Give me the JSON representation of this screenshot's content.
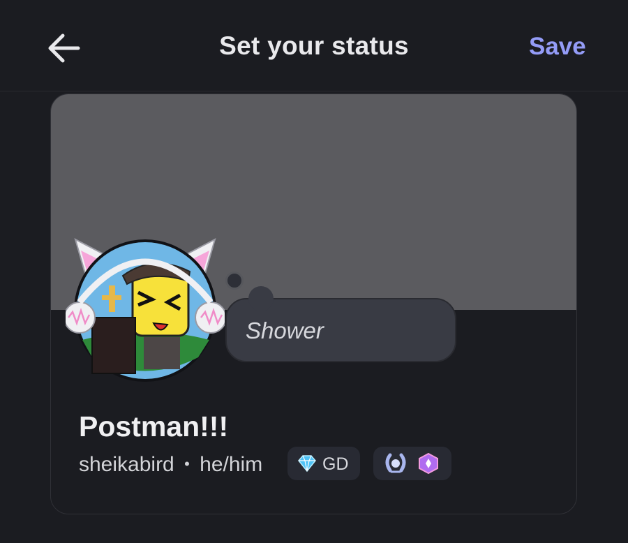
{
  "header": {
    "title": "Set your status",
    "save_label": "Save"
  },
  "profile": {
    "status_text": "Shower",
    "display_name": "Postman!!!",
    "username": "sheikabird",
    "separator": "•",
    "pronouns": "he/him",
    "guild_tag": "GD"
  },
  "icons": {
    "back": "arrow-left-icon",
    "guild_tag": "diamond-icon",
    "badges": [
      "laurel-icon",
      "nitro-gem-icon"
    ]
  },
  "colors": {
    "accent": "#949cf7",
    "banner": "#5b5b5f",
    "background": "#1b1c21"
  }
}
